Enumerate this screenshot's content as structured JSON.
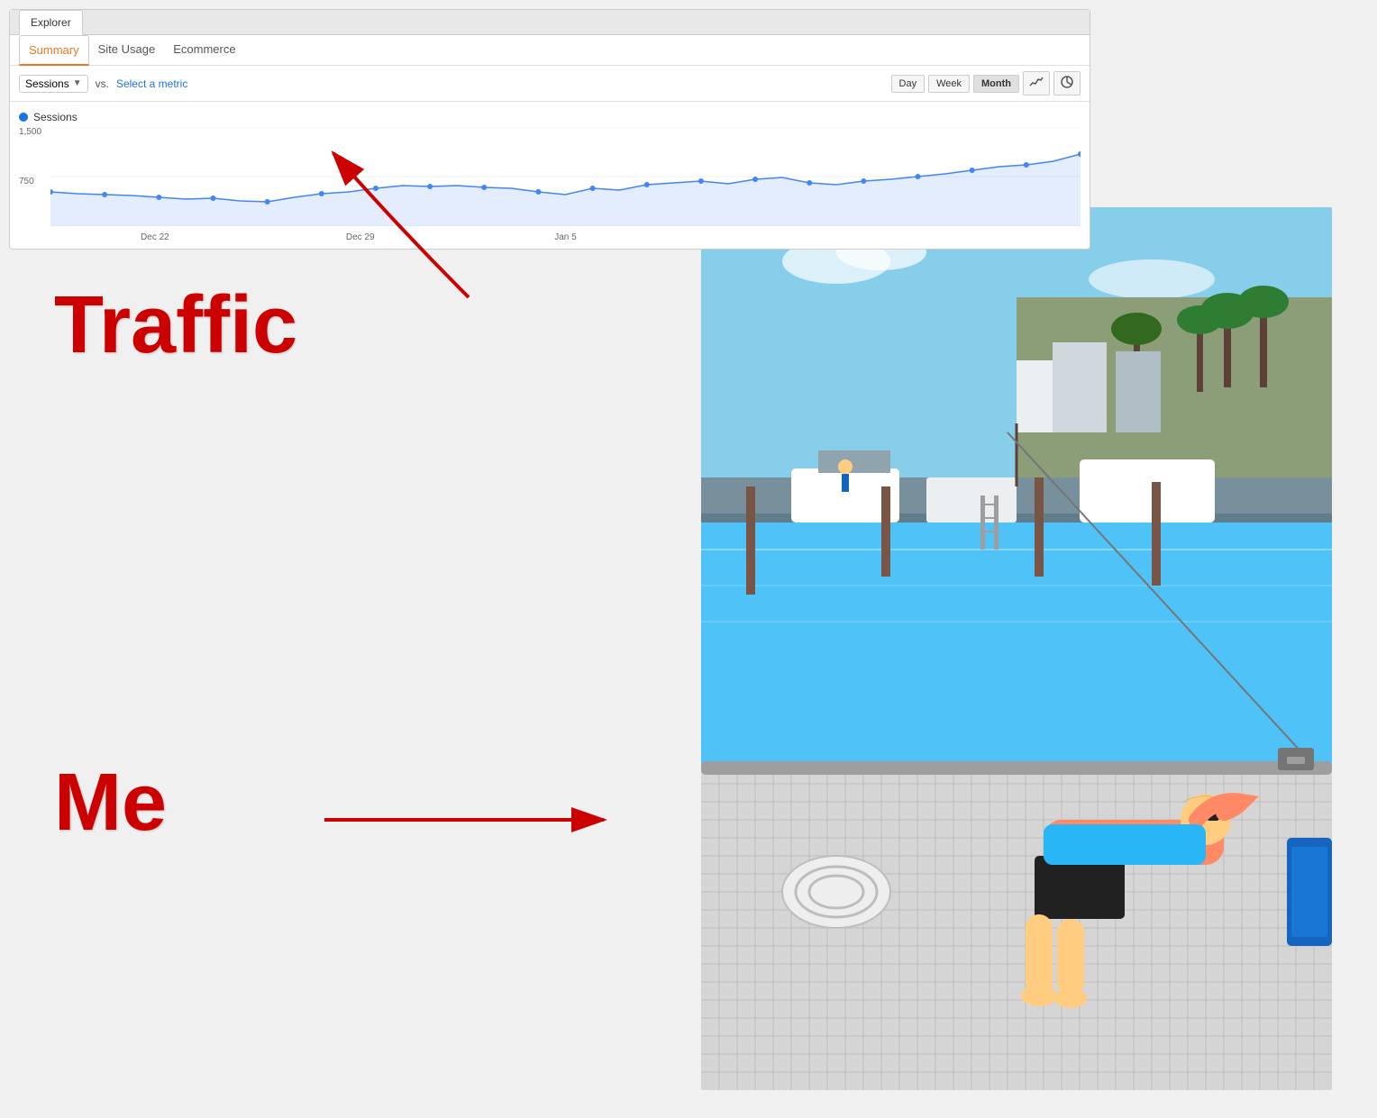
{
  "panel": {
    "tab_bar_label": "Explorer",
    "tabs": [
      {
        "label": "Summary",
        "active": true
      },
      {
        "label": "Site Usage",
        "active": false
      },
      {
        "label": "Ecommerce",
        "active": false
      }
    ],
    "sessions_label": "Sessions",
    "vs_label": "vs.",
    "select_metric_label": "Select a metric",
    "time_buttons": [
      {
        "label": "Day",
        "active": false
      },
      {
        "label": "Week",
        "active": false
      },
      {
        "label": "Month",
        "active": true
      }
    ],
    "chart": {
      "legend_label": "Sessions",
      "y_labels": [
        "1,500",
        "750",
        ""
      ],
      "x_labels": [
        "",
        "Dec 22",
        "",
        "Dec 29",
        "",
        "Jan 5",
        ""
      ],
      "line_icon": "📈",
      "pie_icon": "🥧"
    }
  },
  "annotations": {
    "traffic_label": "Traffic",
    "me_label": "Me"
  }
}
